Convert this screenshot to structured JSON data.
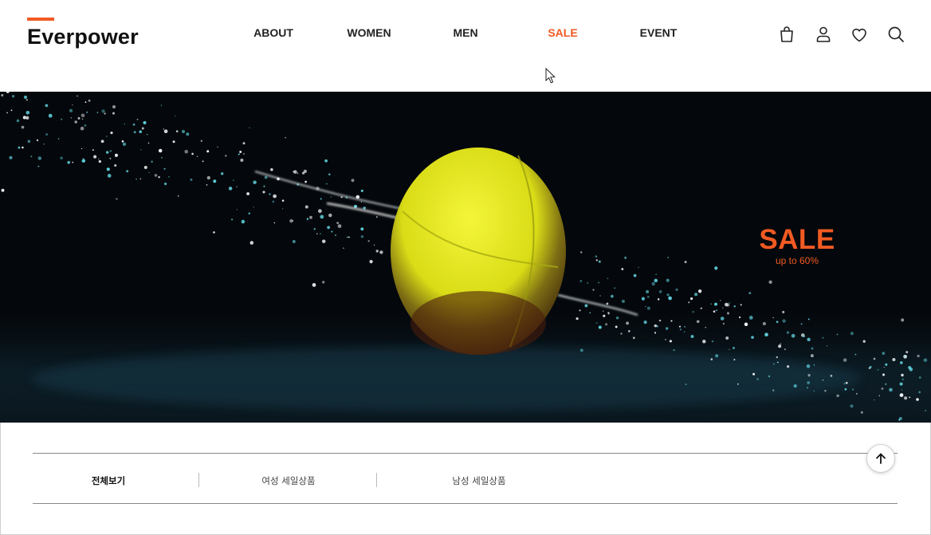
{
  "brand": {
    "logo_text": "Everpower",
    "accent_color": "#f15a22"
  },
  "nav": {
    "items": [
      {
        "label": "ABOUT",
        "active": false
      },
      {
        "label": "WOMEN",
        "active": false
      },
      {
        "label": "MEN",
        "active": false
      },
      {
        "label": "SALE",
        "active": true
      },
      {
        "label": "EVENT",
        "active": false
      }
    ]
  },
  "header_icons": [
    "shopping-bag-icon",
    "user-icon",
    "heart-icon",
    "search-icon"
  ],
  "hero": {
    "title": "SALE",
    "subtitle": "up to 60%"
  },
  "filter_tabs": {
    "items": [
      {
        "label": "전체보기",
        "active": true
      },
      {
        "label": "여성 세일상품",
        "active": false
      },
      {
        "label": "남성 세일상품",
        "active": false
      }
    ]
  },
  "scroll_top_icon": "arrow-up-icon"
}
